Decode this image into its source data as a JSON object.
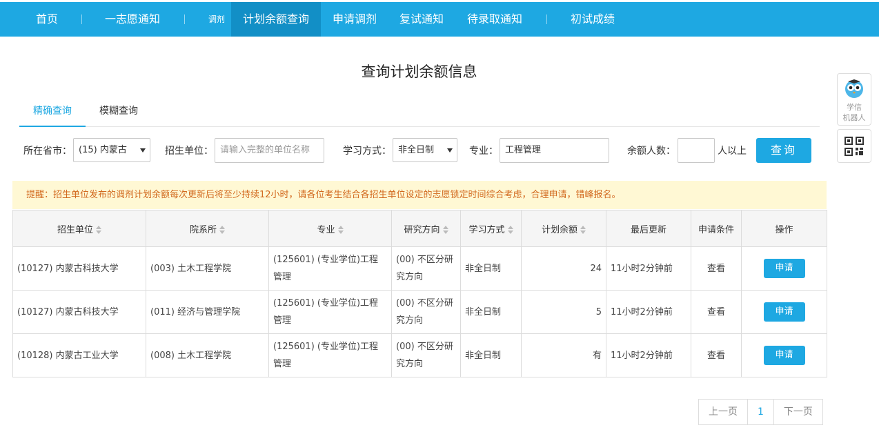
{
  "nav": {
    "items": [
      {
        "label": "首页"
      },
      {
        "label": "一志愿通知"
      },
      {
        "label": "调剂"
      },
      {
        "label": "计划余额查询"
      },
      {
        "label": "申请调剂"
      },
      {
        "label": "复试通知"
      },
      {
        "label": "待录取通知"
      },
      {
        "label": "初试成绩"
      }
    ]
  },
  "page": {
    "title": "查询计划余额信息"
  },
  "tabs": [
    {
      "label": "精确查询"
    },
    {
      "label": "模糊查询"
    }
  ],
  "filters": {
    "province_label": "所在省市：",
    "province_value": "(15) 内蒙古",
    "unit_label": "招生单位：",
    "unit_placeholder": "请输入完整的单位名称",
    "mode_label": "学习方式：",
    "mode_value": "非全日制",
    "major_label": "专业：",
    "major_value": "工程管理",
    "remain_label": "余额人数：",
    "remain_value": "",
    "remain_suffix": "人以上",
    "query_button": "查询"
  },
  "notice": "提醒：招生单位发布的调剂计划余额每次更新后将至少持续12小时，请各位考生结合各招生单位设定的志愿锁定时间综合考虑，合理申请，错峰报名。",
  "table": {
    "headers": [
      "招生单位",
      "院系所",
      "专业",
      "研究方向",
      "学习方式",
      "计划余额",
      "最后更新",
      "申请条件",
      "操作"
    ],
    "rows": [
      {
        "unit": "(10127) 内蒙古科技大学",
        "dept": "(003) 土木工程学院",
        "major": "(125601) (专业学位)工程管理",
        "direction": "(00) 不区分研究方向",
        "mode": "非全日制",
        "remain": "24",
        "updated": "11小时2分钟前",
        "cond": "查看",
        "action": "申请"
      },
      {
        "unit": "(10127) 内蒙古科技大学",
        "dept": "(011) 经济与管理学院",
        "major": "(125601) (专业学位)工程管理",
        "direction": "(00) 不区分研究方向",
        "mode": "非全日制",
        "remain": "5",
        "updated": "11小时2分钟前",
        "cond": "查看",
        "action": "申请"
      },
      {
        "unit": "(10128) 内蒙古工业大学",
        "dept": "(008) 土木工程学院",
        "major": "(125601) (专业学位)工程管理",
        "direction": "(00) 不区分研究方向",
        "mode": "非全日制",
        "remain": "有",
        "updated": "11小时2分钟前",
        "cond": "查看",
        "action": "申请"
      }
    ]
  },
  "pager": {
    "prev": "上一页",
    "current": "1",
    "next": "下一页"
  },
  "side": {
    "robot_label_1": "学信",
    "robot_label_2": "机器人",
    "icons": [
      "robot-owl-icon",
      "qr-code-icon"
    ]
  },
  "colors": {
    "accent": "#1ea8e2",
    "notice_bg": "#fff8d4",
    "notice_text": "#d2691e"
  }
}
